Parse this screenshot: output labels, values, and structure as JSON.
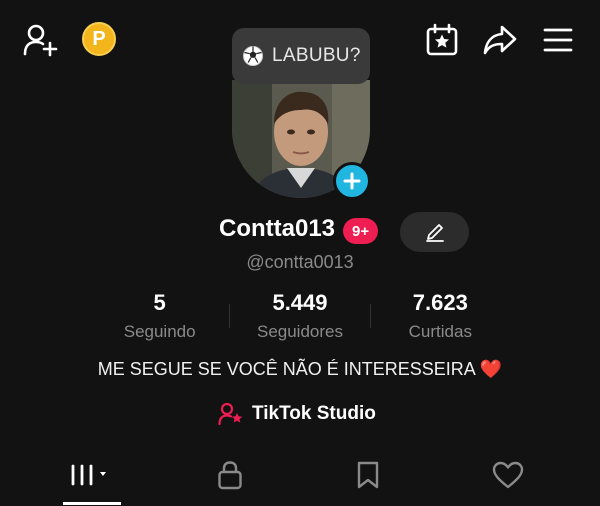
{
  "topbar": {
    "icons": [
      "add-friend-icon",
      "coin-icon",
      "calendar-star-icon",
      "share-icon",
      "menu-icon"
    ],
    "coin_letter": "P"
  },
  "notes_bubble": {
    "icon": "soccer-ball-icon",
    "text": "LABUBU?"
  },
  "profile": {
    "display_name": "Contta013",
    "notification_badge": "9+",
    "username": "@contta0013",
    "bio_text": "ME SEGUE SE VOCÊ NÃO É INTERESSEIRA",
    "bio_emoji": "❤️",
    "studio_label": "TikTok Studio"
  },
  "stats": [
    {
      "value": "5",
      "label": "Seguindo"
    },
    {
      "value": "5.449",
      "label": "Seguidores"
    },
    {
      "value": "7.623",
      "label": "Curtidas"
    }
  ],
  "tabs": [
    {
      "icon": "grid-icon",
      "active": true
    },
    {
      "icon": "lock-icon",
      "active": false
    },
    {
      "icon": "bookmark-icon",
      "active": false
    },
    {
      "icon": "heart-icon",
      "active": false
    }
  ],
  "colors": {
    "background": "#121212",
    "accent_red": "#ee1d52",
    "accent_blue": "#20b6e0",
    "coin_gold": "#f3b51c",
    "muted_text": "#8a8a8a"
  }
}
